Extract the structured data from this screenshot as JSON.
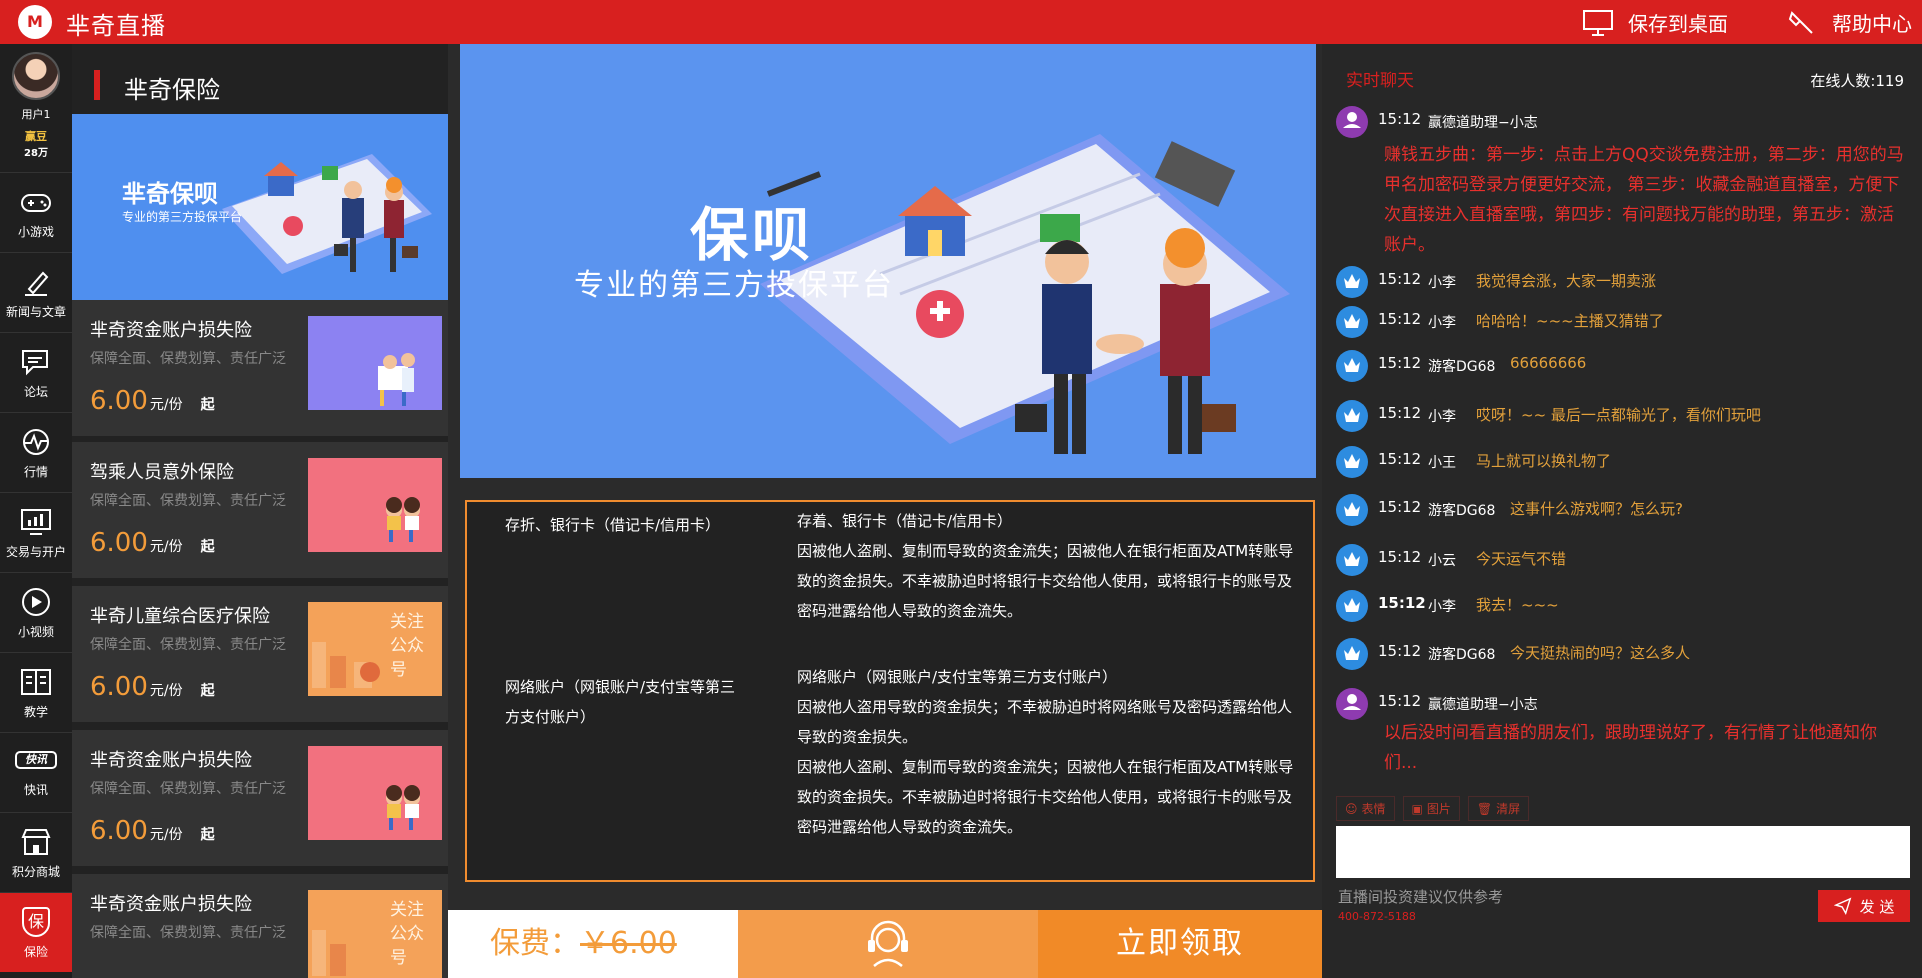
{
  "app": {
    "logo": "M",
    "title": "芈奇直播"
  },
  "header": {
    "save_desktop": "保存到桌面",
    "help_center": "帮助中心"
  },
  "user": {
    "name": "用户1",
    "coin_label": "赢豆",
    "coin_value": "28万"
  },
  "nav": [
    {
      "label": "小游戏",
      "icon": "gamepad-icon"
    },
    {
      "label": "新闻与文章",
      "icon": "pen-icon"
    },
    {
      "label": "论坛",
      "icon": "forum-icon"
    },
    {
      "label": "行情",
      "icon": "chart-wave-icon"
    },
    {
      "label": "交易与开户",
      "icon": "monitor-chart-icon"
    },
    {
      "label": "小视频",
      "icon": "play-icon"
    },
    {
      "label": "教学",
      "icon": "book-icon"
    },
    {
      "label": "快讯",
      "icon_text": "快讯",
      "icon": "news-flash-icon"
    },
    {
      "label": "积分商城",
      "icon": "store-icon"
    },
    {
      "label": "保险",
      "icon_text": "保",
      "icon": "insurance-icon",
      "active": true
    }
  ],
  "panel": {
    "title": "芈奇保险",
    "hero": {
      "title": "芈奇保呗",
      "subtitle": "专业的第三方投保平台"
    },
    "products": [
      {
        "name": "芈奇资金账户损失险",
        "desc": "保障全面、保费划算、责任广泛",
        "price": "6.00",
        "unit": "元/份",
        "suffix": "起",
        "thumb_color": "#8c82f2"
      },
      {
        "name": "驾乘人员意外保险",
        "desc": "保障全面、保费划算、责任广泛",
        "price": "6.00",
        "unit": "元/份",
        "suffix": "起",
        "thumb_color": "#f2717f"
      },
      {
        "name": "芈奇儿童综合医疗保险",
        "desc": "保障全面、保费划算、责任广泛",
        "price": "6.00",
        "unit": "元/份",
        "suffix": "起",
        "thumb_color": "#f4a259",
        "thumb_text": "关注公众号"
      },
      {
        "name": "芈奇资金账户损失险",
        "desc": "保障全面、保费划算、责任广泛",
        "price": "6.00",
        "unit": "元/份",
        "suffix": "起",
        "thumb_color": "#f2717f"
      },
      {
        "name": "芈奇资金账户损失险",
        "desc": "保障全面、保费划算、责任广泛",
        "price": "",
        "unit": "",
        "suffix": "",
        "thumb_color": "#f4a259",
        "thumb_text": "关注公众号"
      }
    ]
  },
  "banner": {
    "title": "保呗",
    "subtitle": "专业的第三方投保平台"
  },
  "coverage": {
    "left_1": "存折、银行卡（借记卡/信用卡）",
    "left_2": "网络账户（网银账户/支付宝等第三方支付账户）",
    "right_1_title": "存着、银行卡（借记卡/信用卡）",
    "right_1_text": "因被他人盗刷、复制而导致的资金流失；因被他人在银行柜面及ATM转账导致的资金损失。不幸被胁迫时将银行卡交给他人使用，或将银行卡的账号及密码泄露给他人导致的资金流失。",
    "right_2_title": "网络账户（网银账户/支付宝等第三方支付账户）",
    "right_2_text": "因被他人盗用导致的资金损失；不幸被胁迫时将网络账号及密码透露给他人导致的资金损失。",
    "right_3_text": "因被他人盗刷、复制而导致的资金流失；因被他人在银行柜面及ATM转账导致的资金损失。不幸被胁迫时将银行卡交给他人使用，或将银行卡的账号及密码泄露给他人导致的资金流失。"
  },
  "purchase": {
    "fee_label": "保费：",
    "fee_amount": "￥6.00",
    "claim": "立即领取"
  },
  "chat": {
    "title": "实时聊天",
    "online": "在线人数:119",
    "messages": [
      {
        "time": "15:12",
        "user": "赢德道助理−小志",
        "role": "admin",
        "badge": "巡管",
        "text": "赚钱五步曲：第一步：点击上方QQ交谈免费注册，第二步：用您的马甲名加密码登录方便更好交流， 第三步：收藏金融道直播室，方便下次直接进入直播室哦，第四步：有问题找万能的助理，第五步：激活账户。"
      },
      {
        "time": "15:12",
        "user": "小李",
        "role": "member",
        "badge": "会员",
        "text": "我觉得会涨，大家一期卖涨"
      },
      {
        "time": "15:12",
        "user": "小李",
        "role": "member",
        "badge": "会员",
        "text": "哈哈哈！~~~主播又猜错了"
      },
      {
        "time": "15:12",
        "user": "游客DG68",
        "role": "member",
        "badge": "会员",
        "text": "66666666"
      },
      {
        "time": "15:12",
        "user": "小李",
        "role": "member",
        "badge": "会员",
        "text": "哎呀！~~ 最后一点都输光了，看你们玩吧"
      },
      {
        "time": "15:12",
        "user": "小王",
        "role": "member",
        "badge": "会员",
        "text": "马上就可以换礼物了"
      },
      {
        "time": "15:12",
        "user": "游客DG68",
        "role": "member",
        "badge": "会员",
        "text": "这事什么游戏啊？怎么玩?"
      },
      {
        "time": "15:12",
        "user": "小云",
        "role": "member",
        "badge": "会员",
        "text": "今天运气不错"
      },
      {
        "time": "15:12",
        "user": "小李",
        "role": "member",
        "badge": "会员",
        "text": "我去！~~~"
      },
      {
        "time": "15:12",
        "user": "游客DG68",
        "role": "member",
        "badge": "会员",
        "text": "今天挺热闹的吗？这么多人"
      },
      {
        "time": "15:12",
        "user": "赢德道助理−小志",
        "role": "admin",
        "badge": "巡管",
        "text": "以后没时间看直播的朋友们，跟助理说好了，有行情了让他通知你们..."
      }
    ],
    "tools": {
      "emoji": "表情",
      "image": "图片",
      "clear": "清屏"
    },
    "input_placeholder": "",
    "disclaimer": "直播间投资建议仅供参考",
    "phone": "400-872-5188",
    "send": "发 送"
  },
  "colors": {
    "brand": "#d8201f",
    "orange": "#f18a27",
    "chat_gold": "#e3a13b"
  }
}
